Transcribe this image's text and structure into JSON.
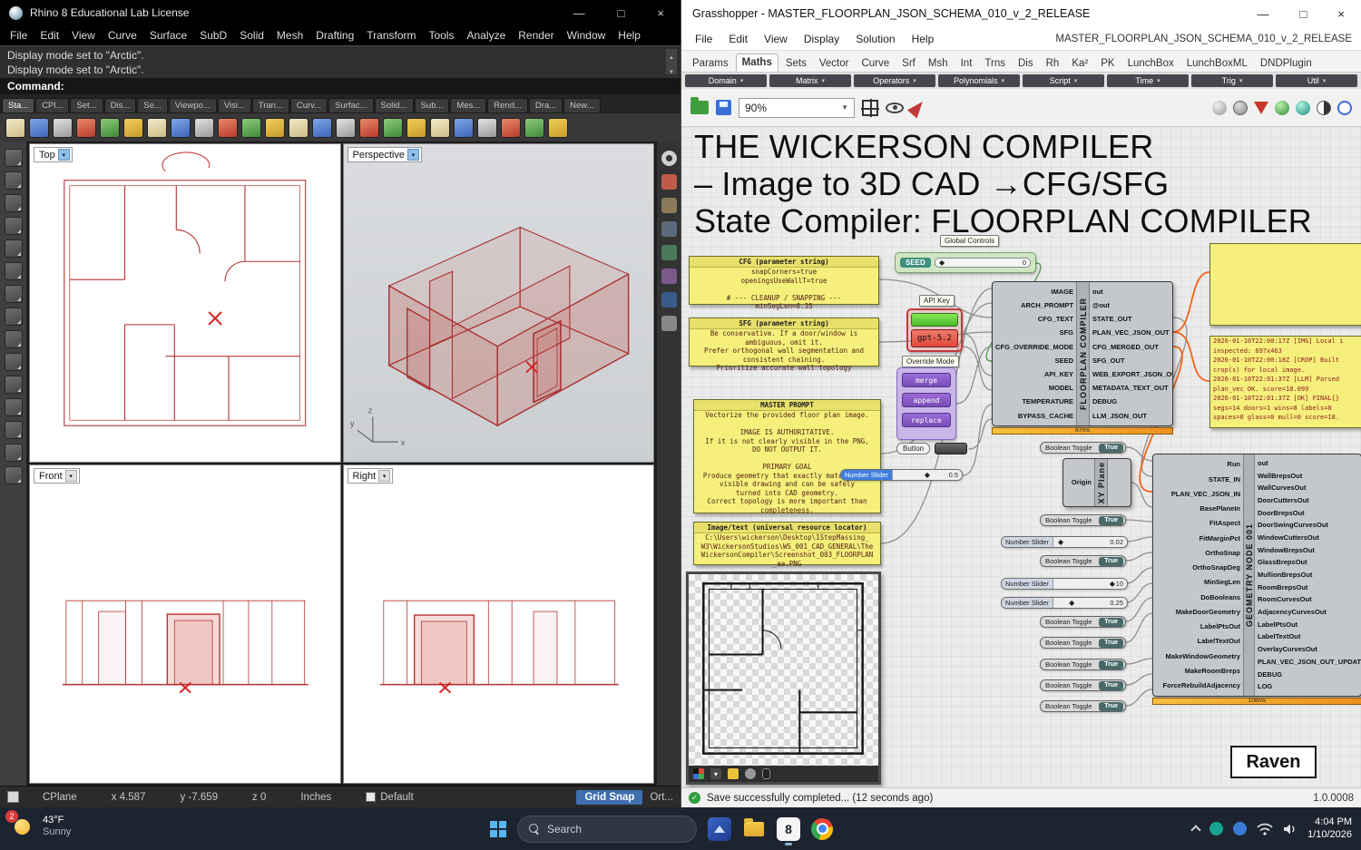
{
  "window_controls": {
    "minimize": "—",
    "maximize": "□",
    "close": "×"
  },
  "rhino": {
    "title": "Rhino 8 Educational Lab License",
    "menu": [
      "File",
      "Edit",
      "View",
      "Curve",
      "Surface",
      "SubD",
      "Solid",
      "Mesh",
      "Drafting",
      "Transform",
      "Tools",
      "Analyze",
      "Render",
      "Window",
      "Help"
    ],
    "history_lines": [
      "Display mode set to \"Arctic\".",
      "Display mode set to \"Arctic\"."
    ],
    "command_label": "Command:",
    "panel_tabs": [
      "Sta...",
      "CPl...",
      "Set...",
      "Dis...",
      "Se...",
      "Viewpo...",
      "Visi...",
      "Tran...",
      "Curv...",
      "Surfac...",
      "Solid...",
      "Sub...",
      "Mes...",
      "Rend...",
      "Dra...",
      "New..."
    ],
    "toolbar_icons": [
      "new-file-icon",
      "open-file-icon",
      "save-icon",
      "print-icon",
      "cut-icon",
      "copy-icon",
      "paste-icon",
      "undo-icon",
      "redo-icon",
      "pan-icon",
      "rotate-view-icon",
      "zoom-icon",
      "zoom-extents-icon",
      "move-icon",
      "gumball-icon",
      "layer-icon",
      "display-icon",
      "object-snap-icon",
      "record-history-icon",
      "filter-icon",
      "boolean-icon",
      "lock-icon",
      "hide-icon",
      "properties-icon"
    ],
    "side_tool_icons": [
      "select-icon",
      "control-point-icon",
      "point-icon",
      "polyline-icon",
      "curve-icon",
      "circle-icon",
      "ellipse-icon",
      "arc-icon",
      "rectangle-icon",
      "polygon-icon",
      "surface-icon",
      "sweep-icon",
      "extrude-icon",
      "solid-icon",
      "mesh-icon"
    ],
    "right_panel_icons": [
      "gear-icon",
      "properties-icon",
      "layers-icon",
      "display-panel-icon",
      "help-icon",
      "materials-icon",
      "rendering-icon",
      "notes-icon"
    ],
    "viewports": {
      "top": "Top",
      "perspective": "Perspective",
      "front": "Front",
      "right": "Right"
    },
    "status_bar": {
      "cplane": "CPlane",
      "x": "x 4.587",
      "y": "y -7.659",
      "z": "z 0",
      "units": "Inches",
      "layer": "Default",
      "grid_snap": "Grid Snap",
      "ortho": "Ort..."
    }
  },
  "grasshopper": {
    "title": "Grasshopper - MASTER_FLOORPLAN_JSON_SCHEMA_010_v_2_RELEASE",
    "menu": [
      "File",
      "Edit",
      "View",
      "Display",
      "Solution",
      "Help"
    ],
    "doc_name": "MASTER_FLOORPLAN_JSON_SCHEMA_010_v_2_RELEASE",
    "tabs": [
      "Params",
      "Maths",
      "Sets",
      "Vector",
      "Curve",
      "Srf",
      "Msh",
      "Int",
      "Trns",
      "Dis",
      "Rh",
      "Ka²",
      "PK",
      "LunchBox",
      "LunchBoxML",
      "DNDPlugin"
    ],
    "active_tab": "Maths",
    "categories": [
      "Domain",
      "Matrix",
      "Operators",
      "Polynomials",
      "Script",
      "Time",
      "Trig",
      "Util"
    ],
    "toolbar": {
      "zoom": "90%"
    },
    "canvas": {
      "title_lines": [
        "THE WICKERSON COMPILER",
        "– Image to 3D CAD →CFG/SFG",
        "State Compiler: FLOORPLAN COMPILER"
      ],
      "cfg_panel": {
        "header": "CFG (parameter string)",
        "lines": [
          "snapCorners=true",
          "openingsUseWallT=true",
          "",
          "# --- CLEANUP / SNAPPING ---",
          "minSegLen=0.35"
        ]
      },
      "sfg_panel": {
        "header": "SFG (parameter string)",
        "lines": [
          "Be conservative. If a door/window is",
          "ambiguous, omit it.",
          "Prefer orthogonal wall segmentation and",
          "consistent chaining.",
          "Prioritize accurate wall topology"
        ]
      },
      "master_prompt_panel": {
        "header": "MASTER PROMPT",
        "lines": [
          "Vectorize the provided floor plan image.",
          "",
          "IMAGE IS AUTHORITATIVE.",
          "If it is not clearly visible in the PNG,",
          "DO NOT OUTPUT IT.",
          "",
          "PRIMARY GOAL",
          "Produce geometry that exactly matches the",
          "visible drawing and can be safely",
          "turned into CAD geometry.",
          "Correct topology is more important than",
          "completeness."
        ]
      },
      "image_path_panel": {
        "header": "Image/text (universal resource locator)",
        "lines": [
          "C:\\Users\\wickerson\\Desktop\\1StepMassing_",
          "W3\\WickersonStudios\\WS_001_CAD_GENERAL\\The",
          "WickersonCompiler\\Screenshot_003_FLOORPLAN",
          "_aa.PNG"
        ]
      },
      "global_controls_label": "Global Controls",
      "seed_slider": {
        "label": "SEED",
        "value": "0"
      },
      "api_key_label": "API Key",
      "model_chip": "gpt-5.2",
      "override_label": "Override Mode",
      "override_options": [
        "merge",
        "append",
        "replace"
      ],
      "button_label": "Button",
      "temp_slider": {
        "label": "Number Slider",
        "value": "0.5"
      },
      "compiler": {
        "name": "FLOORPLAN COMPILER",
        "inputs": [
          "IMAGE",
          "ARCH_PROMPT",
          "CFG_TEXT",
          "SFG",
          "CFG_OVERRIDE_MODE",
          "SEED",
          "API_KEY",
          "MODEL",
          "TEMPERATURE",
          "BYPASS_CACHE"
        ],
        "outputs": [
          "out",
          "@out",
          "STATE_OUT",
          "PLAN_VEC_JSON_OUT",
          "CFG_MERGED_OUT",
          "SFG_OUT",
          "WEB_EXPORT_JSON_OUT",
          "METADATA_TEXT_OUT",
          "DEBUG",
          "LLM_JSON_OUT"
        ],
        "runtime": "87ms"
      },
      "xy_plane": {
        "input": "Origin",
        "name": "XY Plane"
      },
      "side_controls": [
        {
          "type": "toggle",
          "label": "Boolean Toggle",
          "value": "True"
        },
        {
          "type": "toggle",
          "label": "Boolean Toggle",
          "value": "True"
        },
        {
          "type": "slider",
          "label": "Number Slider",
          "value": "0.02"
        },
        {
          "type": "toggle",
          "label": "Boolean Toggle",
          "value": "True"
        },
        {
          "type": "slider",
          "label": "Number Slider",
          "value": "10"
        },
        {
          "type": "slider",
          "label": "Number Slider",
          "value": "0.25"
        },
        {
          "type": "toggle",
          "label": "Boolean Toggle",
          "value": "True"
        },
        {
          "type": "toggle",
          "label": "Boolean Toggle",
          "value": "True"
        },
        {
          "type": "toggle",
          "label": "Boolean Toggle",
          "value": "True"
        },
        {
          "type": "toggle",
          "label": "Boolean Toggle",
          "value": "True"
        },
        {
          "type": "toggle",
          "label": "Boolean Toggle",
          "value": "True"
        }
      ],
      "geometry_node": {
        "name": "GEOMETRY NODE 001",
        "inputs": [
          "Run",
          "STATE_IN",
          "PLAN_VEC_JSON_IN",
          "BasePlaneIn",
          "FitAspect",
          "FitMarginPct",
          "OrthoSnap",
          "OrthoSnapDeg",
          "MinSegLen",
          "DoBooleans",
          "MakeDoorGeometry",
          "LabelPtsOut",
          "LabelTextOut",
          "MakeWindowGeometry",
          "MakeRoomBreps",
          "ForceRebuildAdjacency"
        ],
        "outputs": [
          "out",
          "WallBrepsOut",
          "WallCurvesOut",
          "DoorCuttersOut",
          "DoorBrepsOut",
          "DoorSwingCurvesOut",
          "WindowCuttersOut",
          "WindowBrepsOut",
          "GlassBrepsOut",
          "MullionBrepsOut",
          "RoomBrepsOut",
          "RoomCurvesOut",
          "AdjacencyCurvesOut",
          "LabelPtsOut",
          "LabelTextOut",
          "OverlayCurvesOut",
          "PLAN_VEC_JSON_OUT_UPDATED",
          "DEBUG",
          "LOG"
        ],
        "runtime": "108ms"
      },
      "log_panel": {
        "lines": [
          "2026-01-10T22:00:17Z [IMG] Local i",
          "inspected: 697x463",
          "2026-01-10T22:00:18Z [CROP] Built",
          "crop(s) for local image.",
          "2026-01-10T22:01:37Z [LLM] Parsed",
          "plan_vec OK. score=18.099",
          "2026-01-10T22:01:37Z [OK] FINAL{}",
          "segs=14 doors=1 wins=8 labels=0",
          "spaces=0 glass=0 mull=0 score=18."
        ]
      },
      "preview_bar_icons": [
        "channels-icon",
        "export-icon",
        "paint-icon",
        "mask-icon",
        "device-icon"
      ],
      "raven_label": "Raven"
    },
    "status_bar": {
      "message": "Save successfully completed... (12 seconds ago)",
      "version": "1.0.0008"
    }
  },
  "taskbar": {
    "weather": {
      "badge": "2",
      "temp": "43°F",
      "condition": "Sunny"
    },
    "search_label": "Search",
    "clock": {
      "time": "4:04 PM",
      "date": "1/10/2026"
    }
  }
}
